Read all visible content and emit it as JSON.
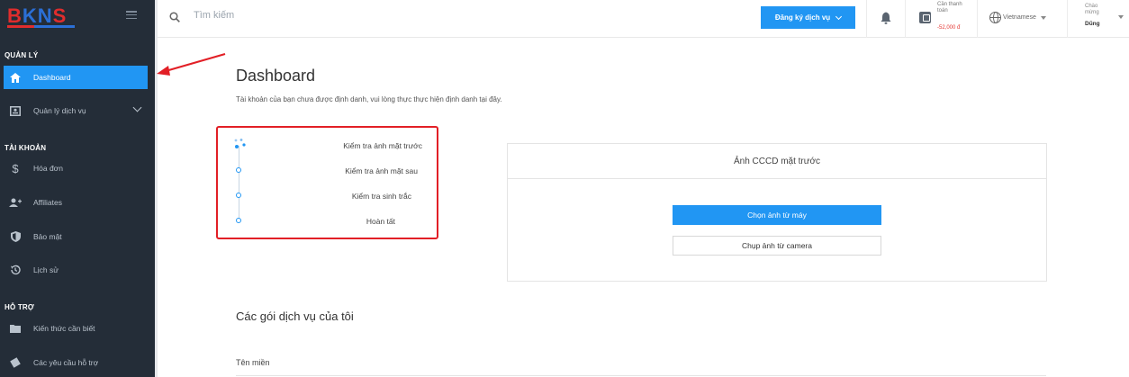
{
  "sidebar": {
    "logo": {
      "b": "B",
      "k": "K",
      "n": "N",
      "s": "S"
    },
    "sections": {
      "manage": "QUẢN LÝ",
      "account": "TÀI KHOẢN",
      "support": "HỖ TRỢ"
    },
    "items": [
      {
        "label": "Dashboard",
        "icon": "home-icon",
        "active": true
      },
      {
        "label": "Quản lý dịch vụ",
        "icon": "id-card-icon"
      },
      {
        "label": "Hóa đơn",
        "icon": "dollar-icon"
      },
      {
        "label": "Affiliates",
        "icon": "users-icon"
      },
      {
        "label": "Bảo mật",
        "icon": "shield-icon"
      },
      {
        "label": "Lịch sử",
        "icon": "history-icon"
      },
      {
        "label": "Kiến thức cần biết",
        "icon": "folder-icon"
      },
      {
        "label": "Các yêu cầu hỗ trợ",
        "icon": "ticket-icon"
      }
    ]
  },
  "topbar": {
    "search_placeholder": "Tìm kiếm",
    "register_label": "Đăng ký dịch vụ",
    "balance_label": "Cần thanh toán",
    "balance_value": "-52,000 đ",
    "language": "Vietnamese",
    "greeting": "Chào mừng",
    "user_name": "Dũng"
  },
  "main": {
    "title": "Dashboard",
    "notice": "Tài khoản của bạn chưa được định danh, vui lòng thực thực hiện định danh tại đây.",
    "steps": [
      "Kiểm tra ảnh mặt trước",
      "Kiểm tra ảnh mặt sau",
      "Kiểm tra sinh trắc",
      "Hoàn tất"
    ],
    "card": {
      "title": "Ảnh CCCD mặt trước",
      "pick_button": "Chọn ảnh từ máy",
      "camera_button": "Chụp ảnh từ camera"
    },
    "services_title": "Các gói dịch vụ của tôi",
    "tab_domain": "Tên miền"
  },
  "colors": {
    "sidebar_bg": "#242d38",
    "accent": "#2196f3",
    "highlight": "#e21f26"
  }
}
